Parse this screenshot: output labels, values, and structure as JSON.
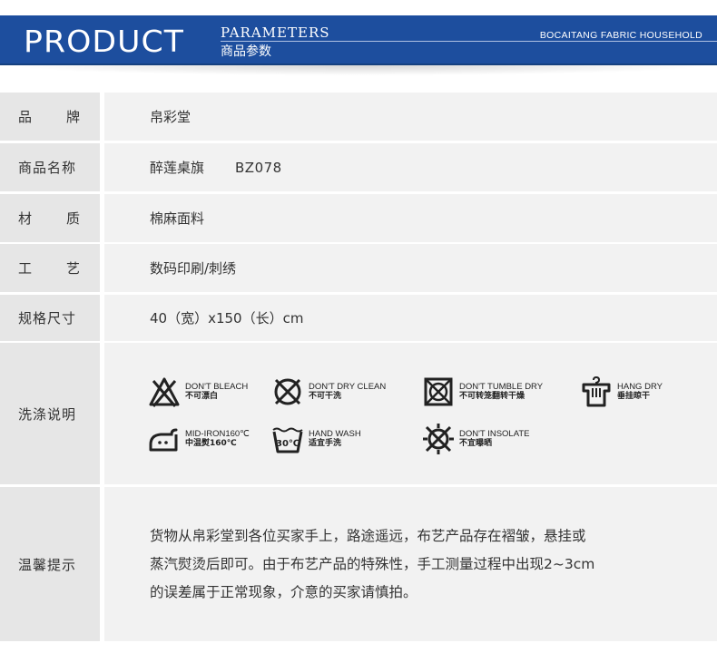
{
  "header": {
    "title": "PRODUCT",
    "subtitle_en": "PARAMETERS",
    "subtitle_cn": "商品参数",
    "brand": "BOCAITANG FABRIC HOUSEHOLD",
    "background_color": "#1d4e9e"
  },
  "rows": {
    "brand": {
      "label_a": "品",
      "label_b": "牌",
      "value": "帛彩堂"
    },
    "name": {
      "label": "商品名称",
      "value": "醉莲桌旗",
      "code": "BZ078"
    },
    "material": {
      "label_a": "材",
      "label_b": "质",
      "value": "棉麻面料"
    },
    "craft": {
      "label_a": "工",
      "label_b": "艺",
      "value": "数码印刷/刺绣"
    },
    "size": {
      "label": "规格尺寸",
      "value": "40（宽）x150（长）cm"
    },
    "care": {
      "label": "洗涤说明",
      "items": [
        {
          "icon": "dont-bleach-icon",
          "en": "DON'T BLEACH",
          "cn": "不可漂白"
        },
        {
          "icon": "dont-dry-clean-icon",
          "en": "DON'T DRY CLEAN",
          "cn": "不可干洗"
        },
        {
          "icon": "dont-tumble-dry-icon",
          "en": "DON'T TUMBLE DRY",
          "cn": "不可转笼翻转干燥"
        },
        {
          "icon": "hang-dry-icon",
          "en": "HANG DRY",
          "cn": "垂挂晾干"
        },
        {
          "icon": "mid-iron-icon",
          "en": "MID-IRON160℃",
          "cn": "中温熨160℃"
        },
        {
          "icon": "hand-wash-icon",
          "en": "HAND WASH",
          "cn": "适宜手洗",
          "icon_text": "30℃"
        },
        {
          "icon": "dont-insolate-icon",
          "en": "DON'T INSOLATE",
          "cn": "不宜曝晒"
        }
      ]
    },
    "notice": {
      "label": "温馨提示",
      "lines": [
        "货物从帛彩堂到各位买家手上，路途遥远，布艺产品存在褶皱，悬挂或",
        "蒸汽熨烫后即可。由于布艺产品的特殊性，手工测量过程中出现2~3cm",
        "的误差属于正常现象，介意的买家请慎拍。"
      ]
    }
  }
}
